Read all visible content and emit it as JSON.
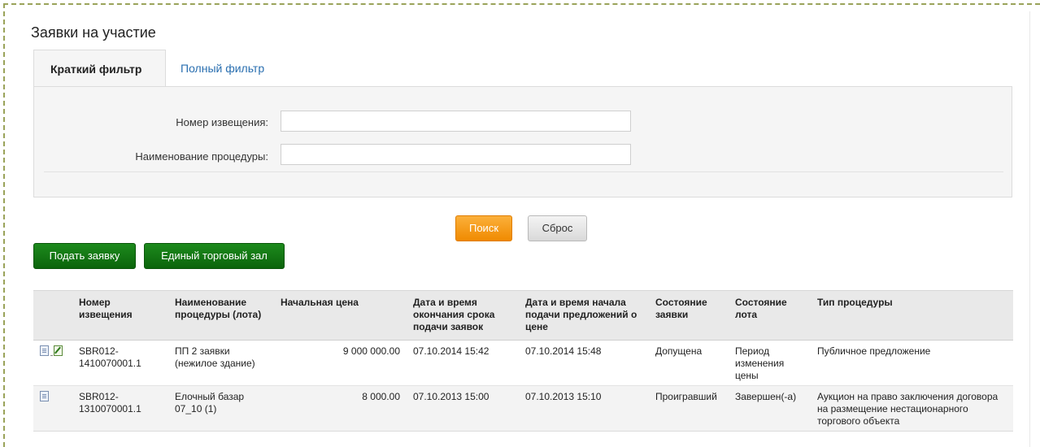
{
  "page": {
    "title": "Заявки на участие"
  },
  "tabs": [
    {
      "label": "Краткий фильтр",
      "active": true
    },
    {
      "label": "Полный фильтр",
      "active": false
    }
  ],
  "filter": {
    "notice_number_label": "Номер извещения:",
    "notice_number_value": "",
    "procedure_name_label": "Наименование процедуры:",
    "procedure_name_value": ""
  },
  "buttons": {
    "search": "Поиск",
    "reset": "Сброс",
    "submit_application": "Подать заявку",
    "trading_hall": "Единый торговый зал"
  },
  "colors": {
    "search_button": "#f39200",
    "green_button": "#127312",
    "link": "#2a6fb0",
    "header_bg": "#e9e9e9"
  },
  "table": {
    "columns": [
      "",
      "Номер извещения",
      "Наименование процедуры (лота)",
      "Начальная цена",
      "Дата и время окончания срока подачи заявок",
      "Дата и время начала подачи предложений о цене",
      "Состояние заявки",
      "Состояние лота",
      "Тип процедуры"
    ],
    "rows": [
      {
        "icons": [
          "document-icon",
          "edit-icon"
        ],
        "number": "SBR012-1410070001.1",
        "name": "ПП 2 заявки (нежилое здание)",
        "price": "9 000 000.00",
        "deadline": "07.10.2014 15:42",
        "bidding_start": "07.10.2014 15:48",
        "application_status": "Допущена",
        "lot_status": "Период изменения цены",
        "procedure_type": "Публичное предложение"
      },
      {
        "icons": [
          "document-icon"
        ],
        "number": "SBR012-1310070001.1",
        "name": "Елочный базар 07_10 (1)",
        "price": "8 000.00",
        "deadline": "07.10.2013 15:00",
        "bidding_start": "07.10.2013 15:10",
        "application_status": "Проигравший",
        "lot_status": "Завершен(-а)",
        "procedure_type": "Аукцион на право заключения договора на размещение нестационарного торгового объекта"
      }
    ]
  }
}
